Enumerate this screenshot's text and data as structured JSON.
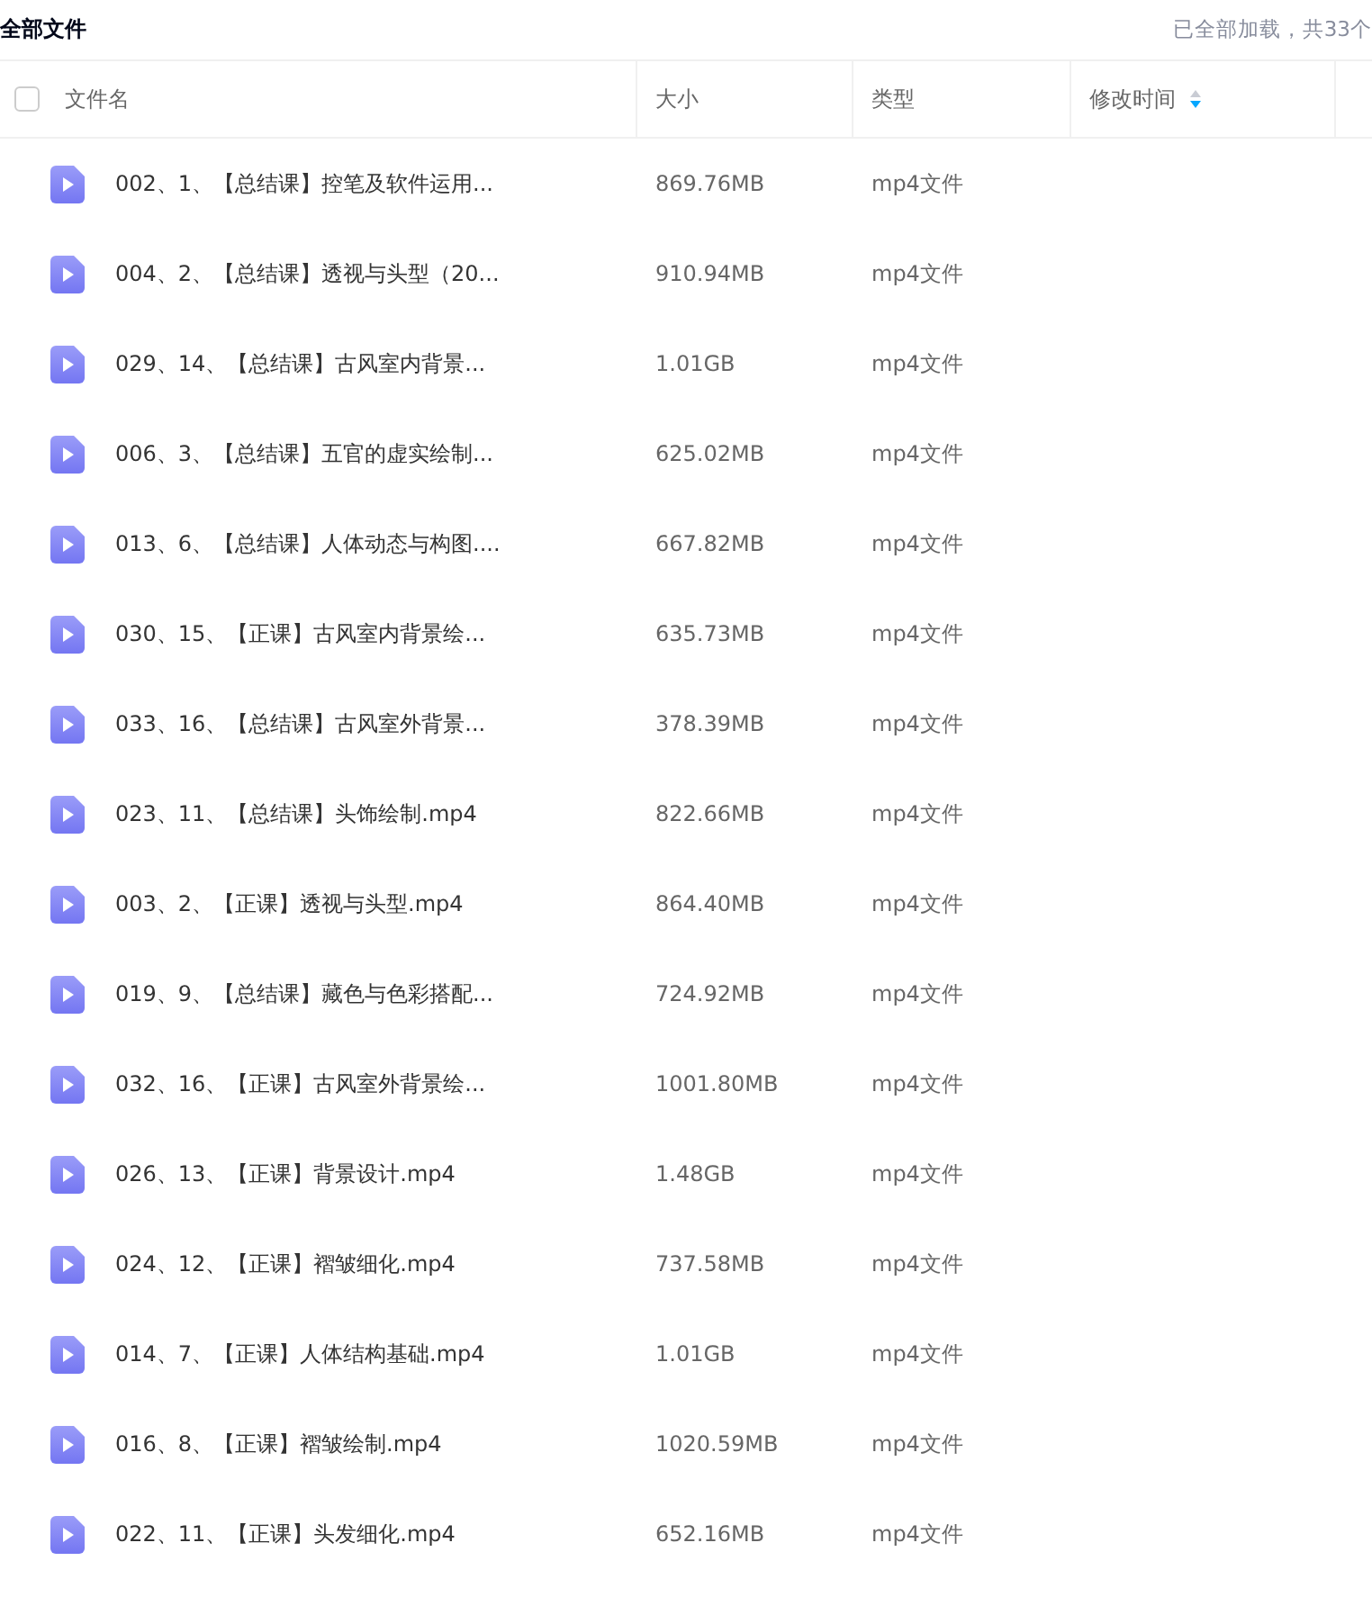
{
  "title": "全部文件",
  "status": "已全部加载，共33个",
  "header": {
    "checked": false,
    "columns": [
      {
        "label": "文件名",
        "sorted": false
      },
      {
        "label": "大小",
        "sorted": false
      },
      {
        "label": "类型",
        "sorted": false
      },
      {
        "label": "修改时间",
        "sorted": true
      }
    ]
  },
  "rows": [
    {
      "name": "002、1、【总结课】控笔及软件运用...",
      "size": "869.76MB",
      "type": "mp4文件"
    },
    {
      "name": "004、2、【总结课】透视与头型（20...",
      "size": "910.94MB",
      "type": "mp4文件"
    },
    {
      "name": "029、14、【总结课】古风室内背景...",
      "size": "1.01GB",
      "type": "mp4文件"
    },
    {
      "name": "006、3、【总结课】五官的虚实绘制...",
      "size": "625.02MB",
      "type": "mp4文件"
    },
    {
      "name": "013、6、【总结课】人体动态与构图....",
      "size": "667.82MB",
      "type": "mp4文件"
    },
    {
      "name": "030、15、【正课】古风室内背景绘...",
      "size": "635.73MB",
      "type": "mp4文件"
    },
    {
      "name": "033、16、【总结课】古风室外背景...",
      "size": "378.39MB",
      "type": "mp4文件"
    },
    {
      "name": "023、11、【总结课】头饰绘制.mp4",
      "size": "822.66MB",
      "type": "mp4文件"
    },
    {
      "name": "003、2、【正课】透视与头型.mp4",
      "size": "864.40MB",
      "type": "mp4文件"
    },
    {
      "name": "019、9、【总结课】藏色与色彩搭配...",
      "size": "724.92MB",
      "type": "mp4文件"
    },
    {
      "name": "032、16、【正课】古风室外背景绘...",
      "size": "1001.80MB",
      "type": "mp4文件"
    },
    {
      "name": "026、13、【正课】背景设计.mp4",
      "size": "1.48GB",
      "type": "mp4文件"
    },
    {
      "name": "024、12、【正课】褶皱细化.mp4",
      "size": "737.58MB",
      "type": "mp4文件"
    },
    {
      "name": "014、7、【正课】人体结构基础.mp4",
      "size": "1.01GB",
      "type": "mp4文件"
    },
    {
      "name": "016、8、【正课】褶皱绘制.mp4",
      "size": "1020.59MB",
      "type": "mp4文件"
    },
    {
      "name": "022、11、【正课】头发细化.mp4",
      "size": "652.16MB",
      "type": "mp4文件"
    }
  ]
}
